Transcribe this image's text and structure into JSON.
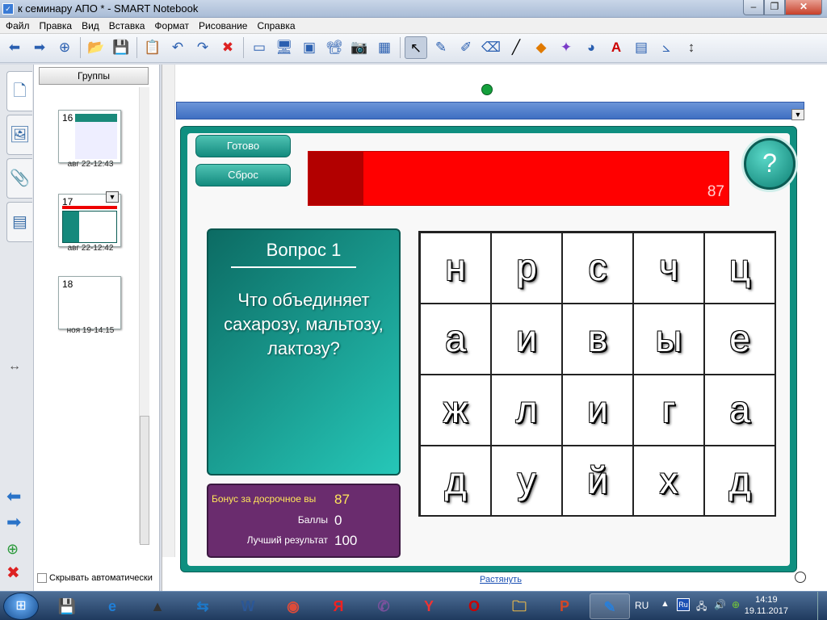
{
  "window": {
    "title": "к семинару АПО * - SMART Notebook",
    "controls": {
      "minimize": "–",
      "maximize": "❐",
      "close": "✕"
    }
  },
  "menu": [
    "Файл",
    "Правка",
    "Вид",
    "Вставка",
    "Формат",
    "Рисование",
    "Справка"
  ],
  "toolbar": {
    "icons": [
      "back-arrow-icon",
      "forward-arrow-icon",
      "add-page-icon",
      "open-folder-icon",
      "save-icon",
      "paste-icon",
      "undo-icon",
      "redo-icon",
      "delete-icon",
      "screen-shade-icon",
      "full-screen-icon",
      "dual-page-icon",
      "document-camera-icon",
      "capture-icon",
      "table-icon",
      "select-icon",
      "pen-icon",
      "creative-pen-icon",
      "eraser-icon",
      "line-icon",
      "shapes-icon",
      "magic-pen-icon",
      "fill-icon",
      "text-icon",
      "properties-icon",
      "measurement-icon",
      "move-toolbar-icon"
    ],
    "glyphs": [
      "⬅",
      "➡",
      "⊕",
      "📂",
      "💾",
      "📋",
      "↶",
      "↷",
      "✖",
      "▭",
      "🖥",
      "▣",
      "📽",
      "📷",
      "▦",
      "↖",
      "✎",
      "✐",
      "⌫",
      "╱",
      "◆",
      "✦",
      "◕",
      "A",
      "▤",
      "⦣",
      "↕"
    ]
  },
  "sidebar": {
    "groups_label": "Группы",
    "pages": [
      {
        "number": "16",
        "date": "авг 22-12:43"
      },
      {
        "number": "17",
        "date": "авг 22-12:42"
      },
      {
        "number": "18",
        "date": "ноя 19-14:15"
      }
    ],
    "auto_hide_label": "Скрывать автоматически",
    "tab_icons": [
      "page-sorter-icon",
      "gallery-icon",
      "attachments-icon",
      "properties-icon"
    ],
    "tab_glyphs": [
      "🗋",
      "🖼",
      "📎",
      "▤"
    ]
  },
  "activity": {
    "buttons": {
      "done": "Готово",
      "reset": "Сброс"
    },
    "timer": {
      "value": "87",
      "fraction_elapsed": 0.13
    },
    "help": "?",
    "question": {
      "title": "Вопрос 1",
      "text": "Что объединяет сахарозу, мальтозу, лактозу?"
    },
    "score": {
      "bonus_label": "Бонус за досрочное вы",
      "bonus_value": "87",
      "points_label": "Баллы",
      "points_value": "0",
      "best_label": "Лучший результат",
      "best_value": "100"
    },
    "grid": [
      [
        "н",
        "р",
        "с",
        "ч",
        "ц"
      ],
      [
        "а",
        "и",
        "в",
        "ы",
        "е"
      ],
      [
        "ж",
        "л",
        "и",
        "г",
        "а"
      ],
      [
        "д",
        "у",
        "й",
        "х",
        "д"
      ]
    ]
  },
  "canvas": {
    "stretch_label": "Растянуть"
  },
  "taskbar": {
    "apps": [
      "save-app",
      "ie-app",
      "archive-app",
      "teamviewer-app",
      "word-app",
      "chrome-app",
      "yandex-app",
      "viber-app",
      "yandex-browser-app",
      "opera-app",
      "explorer-app",
      "powerpoint-app",
      "notebook-app"
    ],
    "app_glyphs": [
      "💾",
      "e",
      "▲",
      "⇆",
      "W",
      "◉",
      "Я",
      "✆",
      "Y",
      "O",
      "🗀",
      "P",
      "✎"
    ],
    "tray": {
      "lang": "RU",
      "time": "14:19",
      "date": "19.11.2017"
    }
  }
}
